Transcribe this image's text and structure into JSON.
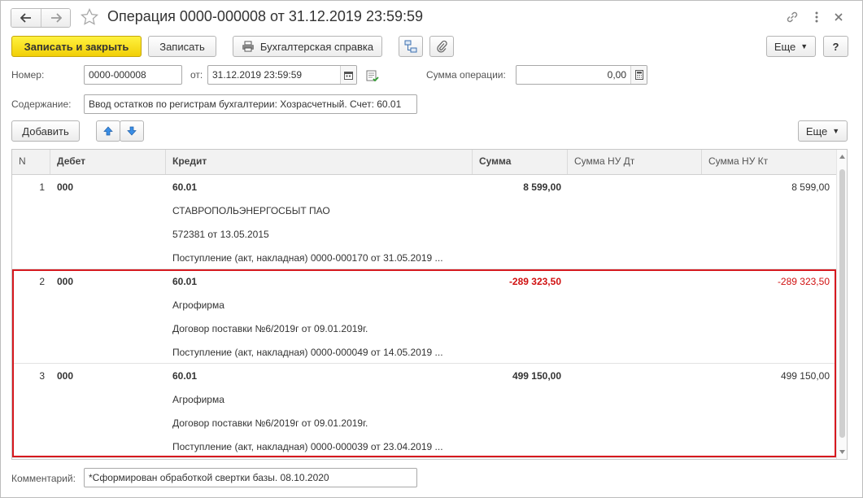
{
  "window": {
    "title": "Операция 0000-000008 от 31.12.2019 23:59:59"
  },
  "icons": {
    "back": "arrow-left-icon",
    "forward": "arrow-right-icon",
    "favorite": "star-icon",
    "link": "link-icon",
    "more": "more-dots-icon",
    "close": "close-icon",
    "print": "printer-icon",
    "structure": "structure-icon",
    "attach": "paperclip-icon",
    "calendar": "calendar-icon",
    "calculator": "calculator-icon",
    "status": "document-status-icon",
    "up": "arrow-up-icon",
    "down": "arrow-down-icon"
  },
  "toolbar": {
    "save_close": "Записать и закрыть",
    "save": "Записать",
    "report": "Бухгалтерская справка",
    "more": "Еще",
    "help": "?"
  },
  "form": {
    "number_label": "Номер:",
    "number_value": "0000-000008",
    "date_label": "от:",
    "date_value": "31.12.2019 23:59:59",
    "sum_label": "Сумма операции:",
    "sum_value": "0,00",
    "content_label": "Содержание:",
    "content_value": "Ввод остатков по регистрам бухгалтерии: Хозрасчетный. Счет: 60.01",
    "comment_label": "Комментарий:",
    "comment_value": "*Сформирован обработкой свертки базы. 08.10.2020"
  },
  "table_toolbar": {
    "add": "Добавить",
    "more": "Еще"
  },
  "table": {
    "columns": [
      "N",
      "Дебет",
      "Кредит",
      "Сумма",
      "Сумма НУ Дт",
      "Сумма НУ Кт"
    ],
    "rows": [
      {
        "n": "1",
        "debit": "000",
        "credit": "60.01",
        "credit_lines": [
          "СТАВРОПОЛЬЭНЕРГОСБЫТ ПАО",
          "572381 от 13.05.2015",
          "Поступление (акт, накладная) 0000-000170 от 31.05.2019 ..."
        ],
        "sum": "8 599,00",
        "sum_nu_dt": "",
        "sum_nu_kt": "8 599,00",
        "negative": false
      },
      {
        "n": "2",
        "debit": "000",
        "credit": "60.01",
        "credit_lines": [
          "Агрофирма",
          "Договор поставки №6/2019г от 09.01.2019г.",
          "Поступление (акт, накладная) 0000-000049 от 14.05.2019 ..."
        ],
        "sum": "-289 323,50",
        "sum_nu_dt": "",
        "sum_nu_kt": "-289 323,50",
        "negative": true
      },
      {
        "n": "3",
        "debit": "000",
        "credit": "60.01",
        "credit_lines": [
          "Агрофирма",
          "Договор поставки №6/2019г от 09.01.2019г.",
          "Поступление (акт, накладная) 0000-000039 от 23.04.2019 ..."
        ],
        "sum": "499 150,00",
        "sum_nu_dt": "",
        "sum_nu_kt": "499 150,00",
        "negative": false
      }
    ]
  },
  "colors": {
    "primary_button": "#f5dc1a",
    "highlight_border": "#d6191f",
    "negative_amount": "#d01010",
    "arrow_blue": "#3a8ee6"
  }
}
